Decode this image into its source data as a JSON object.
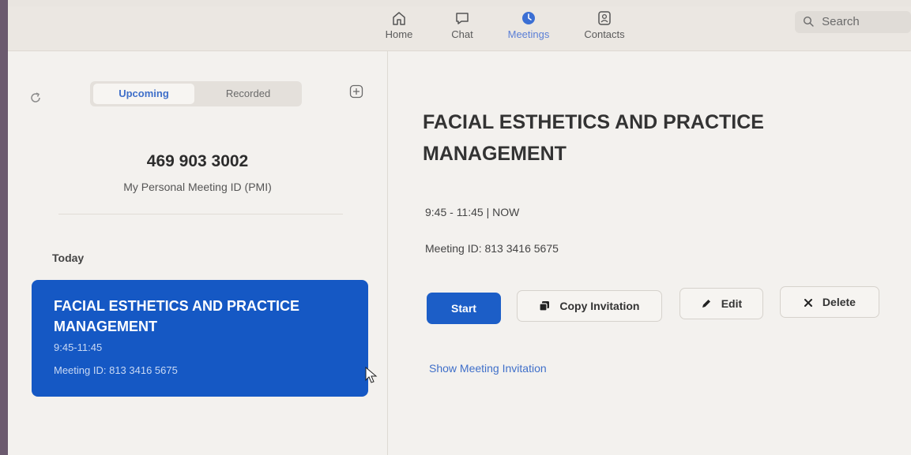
{
  "nav": {
    "items": [
      {
        "label": "Home",
        "icon": "home-icon"
      },
      {
        "label": "Chat",
        "icon": "chat-icon"
      },
      {
        "label": "Meetings",
        "icon": "clock-icon"
      },
      {
        "label": "Contacts",
        "icon": "contacts-icon"
      }
    ],
    "active": "Meetings",
    "search_label": "Search"
  },
  "left": {
    "tabs": [
      "Upcoming",
      "Recorded"
    ],
    "active_tab": "Upcoming",
    "pmi_number": "469 903 3002",
    "pmi_label": "My Personal Meeting ID (PMI)",
    "section_label": "Today",
    "meeting": {
      "title": "FACIAL ESTHETICS AND PRACTICE MANAGEMENT",
      "time": "9:45-11:45",
      "meeting_id": "Meeting ID: 813 3416 5675"
    }
  },
  "detail": {
    "title": "FACIAL ESTHETICS AND PRACTICE MANAGEMENT",
    "time": "9:45 - 11:45  |  NOW",
    "meeting_id": "Meeting ID: 813 3416 5675",
    "buttons": {
      "start": "Start",
      "copy": "Copy Invitation",
      "edit": "Edit",
      "delete": "Delete"
    },
    "show_invitation": "Show Meeting Invitation"
  },
  "colors": {
    "accent": "#1558c4",
    "link": "#3f6fc9",
    "active_nav": "#5b7fd6"
  }
}
